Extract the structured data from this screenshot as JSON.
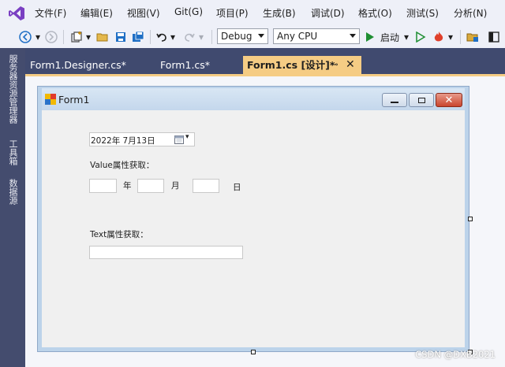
{
  "menubar": {
    "items": [
      "文件(F)",
      "编辑(E)",
      "视图(V)",
      "Git(G)",
      "项目(P)",
      "生成(B)",
      "调试(D)",
      "格式(O)",
      "测试(S)",
      "分析(N)"
    ]
  },
  "toolbar": {
    "config": "Debug",
    "platform": "Any CPU",
    "start_label": "启动"
  },
  "sidebar": {
    "items": [
      "服务器资源管理器",
      "工具箱",
      "数据源"
    ]
  },
  "tabs": [
    {
      "label": "Form1.Designer.cs*",
      "active": false
    },
    {
      "label": "Form1.cs*",
      "active": false
    },
    {
      "label": "Form1.cs [设计]*",
      "active": true
    }
  ],
  "form": {
    "title": "Form1",
    "date_picker_value": "2022年  7月13日",
    "value_label": "Value属性获取：",
    "year_label": "年",
    "month_label": "月",
    "day_label": "日",
    "text_label": "Text属性获取："
  },
  "watermark": "CSDN @DXB2021"
}
